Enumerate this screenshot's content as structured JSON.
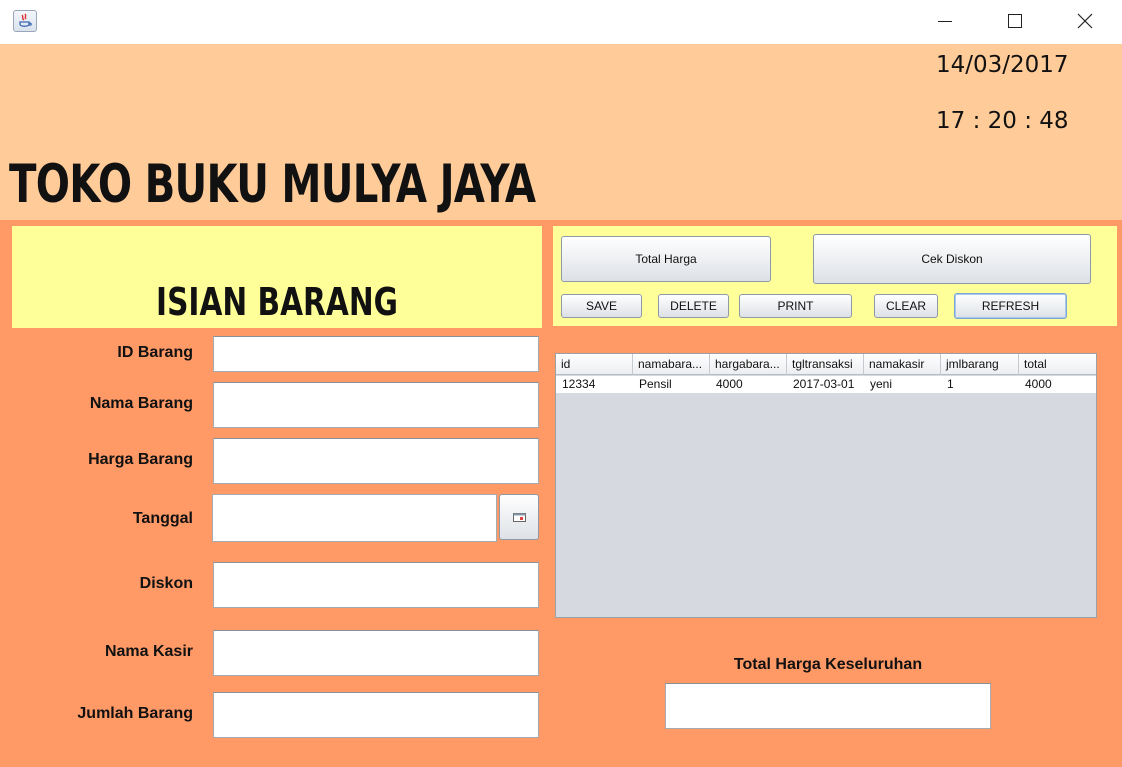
{
  "window": {
    "icon": "java-icon",
    "controls": [
      "minimize-icon",
      "maximize-icon",
      "close-icon"
    ]
  },
  "header": {
    "date": "14/03/2017",
    "time": "17 : 20 : 48",
    "store_name": "TOKO BUKU MULYA JAYA"
  },
  "form": {
    "section_title": "ISIAN BARANG",
    "fields": {
      "id_barang": {
        "label": "ID Barang",
        "value": ""
      },
      "nama_barang": {
        "label": "Nama Barang",
        "value": ""
      },
      "harga_barang": {
        "label": "Harga Barang",
        "value": ""
      },
      "tanggal": {
        "label": "Tanggal",
        "value": ""
      },
      "diskon": {
        "label": "Diskon",
        "value": ""
      },
      "nama_kasir": {
        "label": "Nama Kasir",
        "value": ""
      },
      "jumlah_barang": {
        "label": "Jumlah Barang",
        "value": ""
      }
    }
  },
  "buttons": {
    "total_harga": "Total Harga",
    "cek_diskon": "Cek Diskon",
    "save": "SAVE",
    "delete": "DELETE",
    "print": "PRINT",
    "clear": "CLEAR",
    "refresh": "REFRESH"
  },
  "table": {
    "columns": [
      "id",
      "namabara...",
      "hargabara...",
      "tgltransaksi",
      "namakasir",
      "jmlbarang",
      "total"
    ],
    "rows": [
      [
        "12334",
        "Pensil",
        "4000",
        "2017-03-01",
        "yeni",
        "1",
        "4000"
      ]
    ]
  },
  "summary": {
    "total_label": "Total Harga Keseluruhan",
    "total_value": ""
  },
  "colors": {
    "header_bg": "#ffcc99",
    "main_bg": "#ff9966",
    "panel_bg": "#ffff99"
  }
}
